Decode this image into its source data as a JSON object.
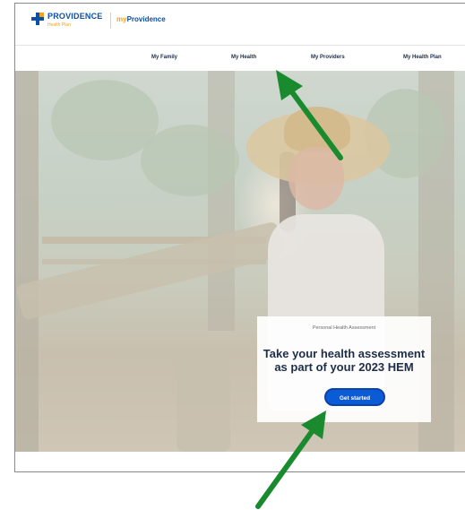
{
  "header": {
    "logo_main": "PROVIDENCE",
    "logo_sub": "Health Plan",
    "brand_my": "my",
    "brand_name": "Providence"
  },
  "nav": {
    "items": [
      {
        "label": "My Family"
      },
      {
        "label": "My Health"
      },
      {
        "label": "My Providers"
      },
      {
        "label": "My Health Plan"
      }
    ]
  },
  "hero_card": {
    "eyebrow": "Personal Health Assessment",
    "title_line1": "Take your health assessment",
    "title_line2": "as part of your 2023 HEM",
    "cta_label": "Get started"
  },
  "colors": {
    "brand_blue": "#0b4fa8",
    "brand_orange": "#f2a31b",
    "cta_blue": "#0b5bd7",
    "annotation_arrow": "#1a8a2e"
  },
  "annotations": {
    "arrows": [
      {
        "points_to": "My Health",
        "icon": "green-arrow-icon"
      },
      {
        "points_to": "Get started",
        "icon": "green-arrow-icon"
      }
    ]
  }
}
